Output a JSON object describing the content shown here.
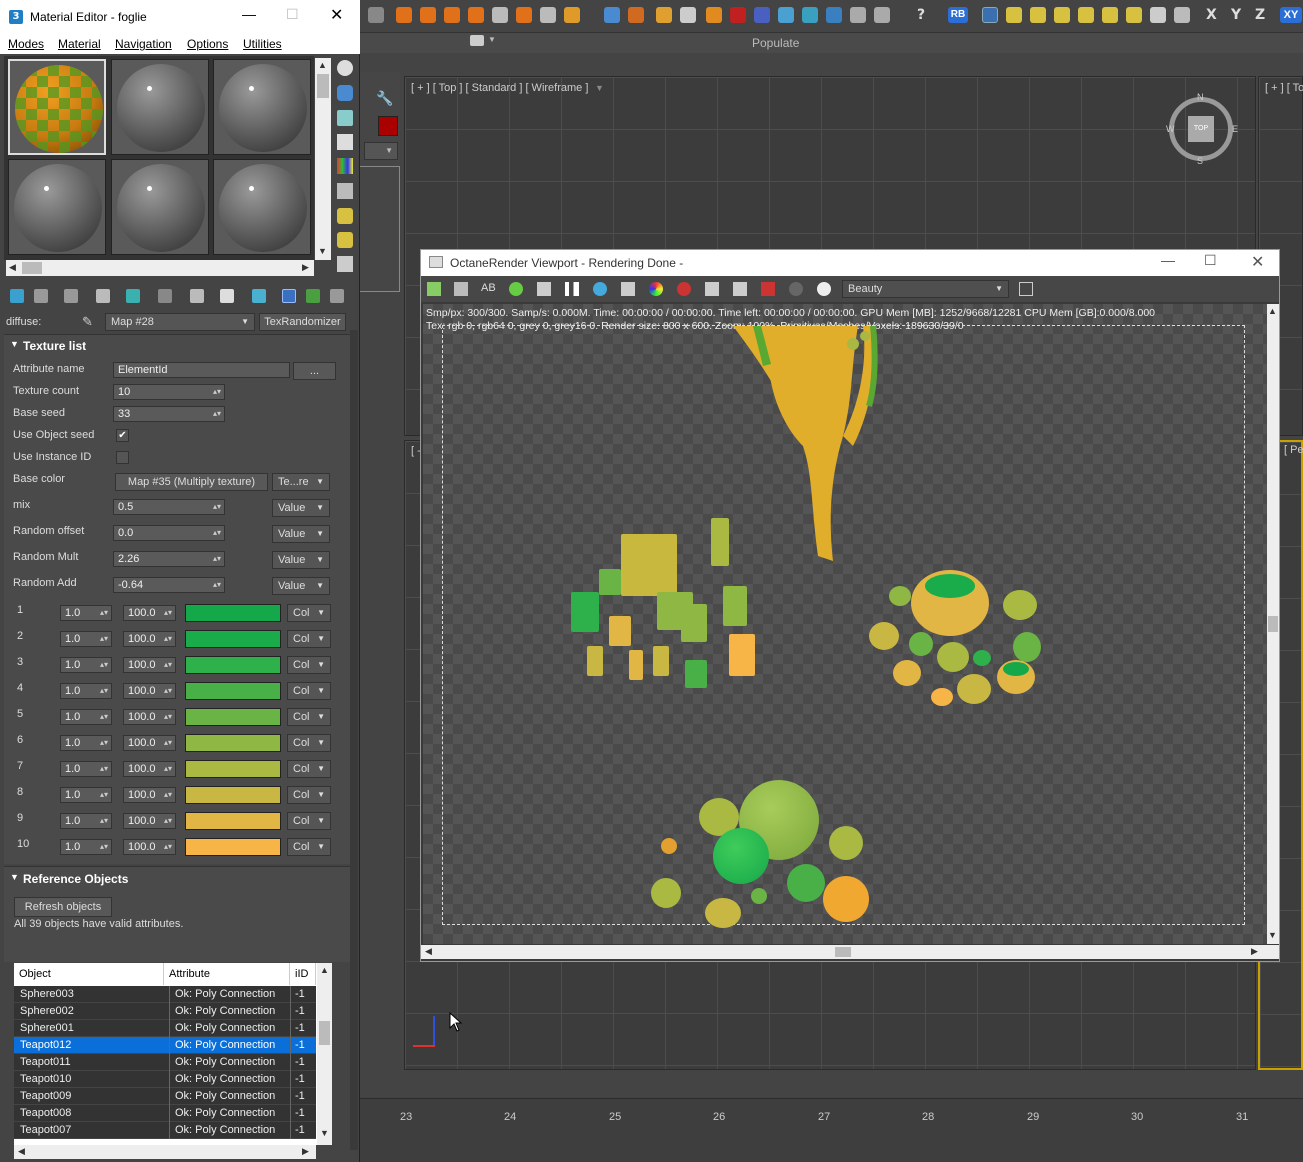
{
  "material_editor": {
    "title": "Material Editor - foglie",
    "menu": [
      "Modes",
      "Material",
      "Navigation",
      "Options",
      "Utilities"
    ],
    "diffuse_label": "diffuse:",
    "map_name": "Map #28",
    "map_type_button": "TexRandomizer",
    "texture_list": {
      "header": "Texture list",
      "attribute_name_label": "Attribute name",
      "attribute_name_value": "ElementId",
      "browse_button": "...",
      "texture_count_label": "Texture count",
      "texture_count_value": "10",
      "base_seed_label": "Base seed",
      "base_seed_value": "33",
      "use_object_seed_label": "Use Object seed",
      "use_object_seed_checked": "✔",
      "use_instance_id_label": "Use Instance ID",
      "base_color_label": "Base color",
      "base_color_map": "Map #35 (Multiply texture)",
      "base_color_mode": "Te...re",
      "mix_label": "mix",
      "mix_value": "0.5",
      "mix_mode": "Value",
      "random_offset_label": "Random offset",
      "random_offset_value": "0.0",
      "random_offset_mode": "Value",
      "random_mult_label": "Random Mult",
      "random_mult_value": "2.26",
      "random_mult_mode": "Value",
      "random_add_label": "Random Add",
      "random_add_value": "-0.64",
      "random_add_mode": "Value",
      "rows": [
        {
          "num": "1",
          "weight": "1.0",
          "pct": "100.0",
          "color": "#15a84a",
          "mode": "Col"
        },
        {
          "num": "2",
          "weight": "1.0",
          "pct": "100.0",
          "color": "#1aab4b",
          "mode": "Col"
        },
        {
          "num": "3",
          "weight": "1.0",
          "pct": "100.0",
          "color": "#2eb04a",
          "mode": "Col"
        },
        {
          "num": "4",
          "weight": "1.0",
          "pct": "100.0",
          "color": "#49b047",
          "mode": "Col"
        },
        {
          "num": "5",
          "weight": "1.0",
          "pct": "100.0",
          "color": "#6ab445",
          "mode": "Col"
        },
        {
          "num": "6",
          "weight": "1.0",
          "pct": "100.0",
          "color": "#8eb743",
          "mode": "Col"
        },
        {
          "num": "7",
          "weight": "1.0",
          "pct": "100.0",
          "color": "#a9b942",
          "mode": "Col"
        },
        {
          "num": "8",
          "weight": "1.0",
          "pct": "100.0",
          "color": "#c8b743",
          "mode": "Col"
        },
        {
          "num": "9",
          "weight": "1.0",
          "pct": "100.0",
          "color": "#e2b645",
          "mode": "Col"
        },
        {
          "num": "10",
          "weight": "1.0",
          "pct": "100.0",
          "color": "#f7b447",
          "mode": "Col"
        }
      ]
    },
    "reference_objects": {
      "header": "Reference Objects",
      "refresh_button": "Refresh objects",
      "status": "All 39 objects have valid attributes.",
      "columns": [
        "Object",
        "Attribute",
        "iID"
      ],
      "rows": [
        {
          "object": "Sphere003",
          "attribute": "Ok: Poly Connection",
          "iid": "-1",
          "selected": false
        },
        {
          "object": "Sphere002",
          "attribute": "Ok: Poly Connection",
          "iid": "-1",
          "selected": false
        },
        {
          "object": "Sphere001",
          "attribute": "Ok: Poly Connection",
          "iid": "-1",
          "selected": false
        },
        {
          "object": "Teapot012",
          "attribute": "Ok: Poly Connection",
          "iid": "-1",
          "selected": true
        },
        {
          "object": "Teapot011",
          "attribute": "Ok: Poly Connection",
          "iid": "-1",
          "selected": false
        },
        {
          "object": "Teapot010",
          "attribute": "Ok: Poly Connection",
          "iid": "-1",
          "selected": false
        },
        {
          "object": "Teapot009",
          "attribute": "Ok: Poly Connection",
          "iid": "-1",
          "selected": false
        },
        {
          "object": "Teapot008",
          "attribute": "Ok: Poly Connection",
          "iid": "-1",
          "selected": false
        },
        {
          "object": "Teapot007",
          "attribute": "Ok: Poly Connection",
          "iid": "-1",
          "selected": false
        }
      ]
    }
  },
  "max": {
    "ribbon_label": "Populate",
    "viewport_top_label": "[ + ] [ Top ] [ Standard ] [ Wireframe ]",
    "viewport_right_label": "[ + ] [ To",
    "viewport_left_label": "[ -",
    "viewport_persp_label": "[ Pe",
    "viewcube_label": "TOP",
    "compass": {
      "n": "N",
      "s": "S",
      "e": "E",
      "w": "W"
    },
    "axis_buttons": [
      "X",
      "Y",
      "Z",
      "XY"
    ],
    "timeline_ticks": [
      "23",
      "24",
      "25",
      "26",
      "27",
      "28",
      "29",
      "30",
      "31"
    ],
    "toolbar_badge": "RB"
  },
  "octane": {
    "title": "OctaneRender Viewport - Rendering Done -",
    "pass_dropdown": "Beauty",
    "ab_label": "AB",
    "stats_line1": "Smp/px: 300/300.   Samp/s: 0.000M.   Time: 00:00:00 / 00:00:00.   Time left: 00:00:00 / 00:00:00.   GPU Mem [MB]: 1252/9668/12281   CPU Mem [GB]:0.000/8.000",
    "stats_line2": "Tex: rgb 0, rgb64 0, grey 0, grey16 0.   Render size: 800 x 600.   Zoom: 100%.   Primitives/Meshes/Voxels: 189630/39/0"
  }
}
